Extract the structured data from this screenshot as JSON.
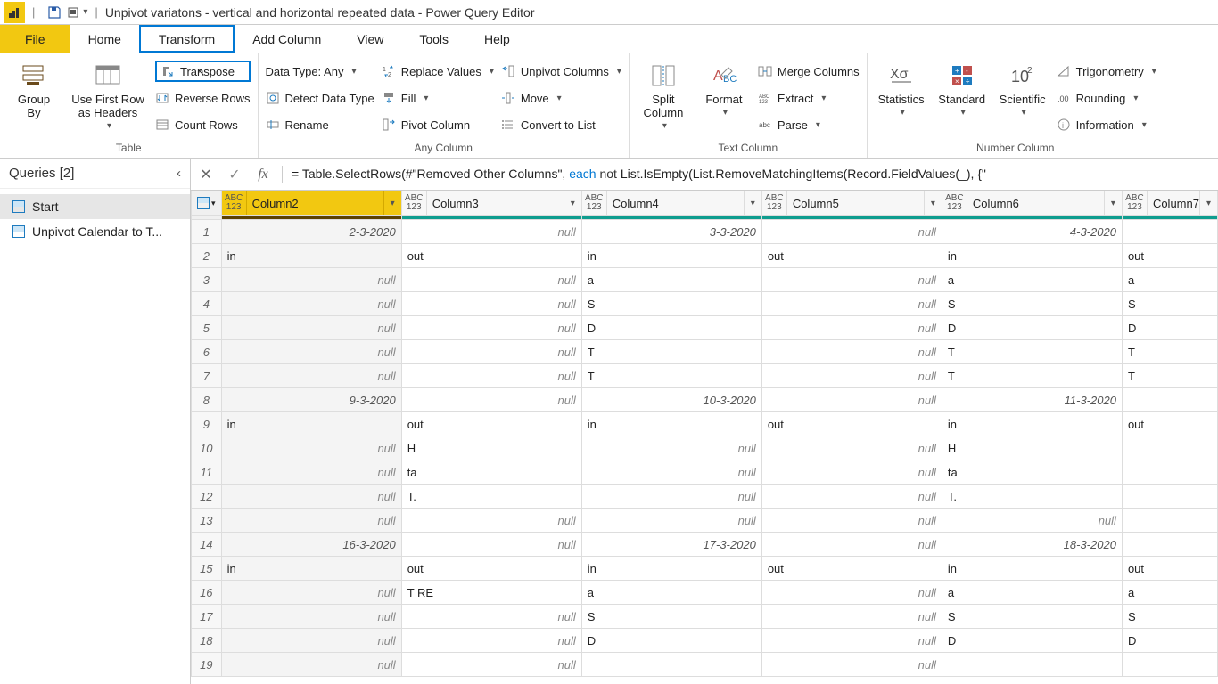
{
  "titlebar": {
    "title": "Unpivot variatons  - vertical and horizontal repeated data - Power Query Editor"
  },
  "menu": {
    "file": "File",
    "home": "Home",
    "transform": "Transform",
    "add_column": "Add Column",
    "view": "View",
    "tools": "Tools",
    "help": "Help"
  },
  "ribbon": {
    "table": {
      "label": "Table",
      "group_by": "Group\nBy",
      "use_first_row": "Use First Row\nas Headers",
      "transpose": "Transpose",
      "reverse_rows": "Reverse Rows",
      "count_rows": "Count Rows"
    },
    "any_column": {
      "label": "Any Column",
      "data_type": "Data Type: Any",
      "detect_data_type": "Detect Data Type",
      "rename": "Rename",
      "replace_values": "Replace Values",
      "fill": "Fill",
      "pivot": "Pivot Column",
      "unpivot": "Unpivot Columns",
      "move": "Move",
      "convert_to_list": "Convert to List"
    },
    "text_column": {
      "label": "Text Column",
      "split": "Split\nColumn",
      "format": "Format",
      "merge": "Merge Columns",
      "extract": "Extract",
      "parse": "Parse"
    },
    "number_column": {
      "label": "Number Column",
      "statistics": "Statistics",
      "standard": "Standard",
      "scientific": "Scientific",
      "trigonometry": "Trigonometry",
      "rounding": "Rounding",
      "information": "Information"
    }
  },
  "queries": {
    "header": "Queries [2]",
    "items": [
      "Start",
      "Unpivot Calendar to T..."
    ]
  },
  "formula": {
    "prefix": "= Table.SelectRows(#\"Removed Other Columns\", ",
    "each": "each",
    "not": " not ",
    "rest": "List.IsEmpty(List.RemoveMatchingItems(Record.FieldValues(_), {\""
  },
  "columns": [
    {
      "name": "Column2",
      "selected": true
    },
    {
      "name": "Column3",
      "selected": false
    },
    {
      "name": "Column4",
      "selected": false
    },
    {
      "name": "Column5",
      "selected": false
    },
    {
      "name": "Column6",
      "selected": false
    },
    {
      "name": "Column7",
      "selected": false
    }
  ],
  "type_icon_label": "ABC\n123",
  "rows": [
    {
      "n": 1,
      "c": [
        "2-3-2020",
        "null",
        "3-3-2020",
        "null",
        "4-3-2020",
        ""
      ],
      "align": [
        "r",
        "r",
        "r",
        "r",
        "r",
        "l"
      ]
    },
    {
      "n": 2,
      "c": [
        "in",
        "out",
        "in",
        "out",
        "in",
        "out"
      ],
      "align": [
        "l",
        "l",
        "l",
        "l",
        "l",
        "l"
      ]
    },
    {
      "n": 3,
      "c": [
        "null",
        "null",
        "a",
        "null",
        "a",
        "a"
      ],
      "align": [
        "r",
        "r",
        "l",
        "r",
        "l",
        "l"
      ]
    },
    {
      "n": 4,
      "c": [
        "null",
        "null",
        "S",
        "null",
        "S",
        "S"
      ],
      "align": [
        "r",
        "r",
        "l",
        "r",
        "l",
        "l"
      ]
    },
    {
      "n": 5,
      "c": [
        "null",
        "null",
        "D",
        "null",
        "D",
        "D"
      ],
      "align": [
        "r",
        "r",
        "l",
        "r",
        "l",
        "l"
      ]
    },
    {
      "n": 6,
      "c": [
        "null",
        "null",
        "T",
        "null",
        "T",
        "T"
      ],
      "align": [
        "r",
        "r",
        "l",
        "r",
        "l",
        "l"
      ]
    },
    {
      "n": 7,
      "c": [
        "null",
        "null",
        "T",
        "null",
        "T",
        "T"
      ],
      "align": [
        "r",
        "r",
        "l",
        "r",
        "l",
        "l"
      ]
    },
    {
      "n": 8,
      "c": [
        "9-3-2020",
        "null",
        "10-3-2020",
        "null",
        "11-3-2020",
        ""
      ],
      "align": [
        "r",
        "r",
        "r",
        "r",
        "r",
        "l"
      ]
    },
    {
      "n": 9,
      "c": [
        "in",
        "out",
        "in",
        "out",
        "in",
        "out"
      ],
      "align": [
        "l",
        "l",
        "l",
        "l",
        "l",
        "l"
      ]
    },
    {
      "n": 10,
      "c": [
        "null",
        "H",
        "null",
        "null",
        "H",
        ""
      ],
      "align": [
        "r",
        "l",
        "r",
        "r",
        "l",
        "l"
      ]
    },
    {
      "n": 11,
      "c": [
        "null",
        "ta",
        "null",
        "null",
        "ta",
        ""
      ],
      "align": [
        "r",
        "l",
        "r",
        "r",
        "l",
        "l"
      ]
    },
    {
      "n": 12,
      "c": [
        "null",
        "T.",
        "null",
        "null",
        "T.",
        ""
      ],
      "align": [
        "r",
        "l",
        "r",
        "r",
        "l",
        "l"
      ]
    },
    {
      "n": 13,
      "c": [
        "null",
        "null",
        "null",
        "null",
        "null",
        ""
      ],
      "align": [
        "r",
        "r",
        "r",
        "r",
        "r",
        "l"
      ]
    },
    {
      "n": 14,
      "c": [
        "16-3-2020",
        "null",
        "17-3-2020",
        "null",
        "18-3-2020",
        ""
      ],
      "align": [
        "r",
        "r",
        "r",
        "r",
        "r",
        "l"
      ]
    },
    {
      "n": 15,
      "c": [
        "in",
        "out",
        "in",
        "out",
        "in",
        "out"
      ],
      "align": [
        "l",
        "l",
        "l",
        "l",
        "l",
        "l"
      ]
    },
    {
      "n": 16,
      "c": [
        "null",
        "T RE",
        "a",
        "null",
        "a",
        "a"
      ],
      "align": [
        "r",
        "l",
        "l",
        "r",
        "l",
        "l"
      ]
    },
    {
      "n": 17,
      "c": [
        "null",
        "null",
        "S",
        "null",
        "S",
        "S"
      ],
      "align": [
        "r",
        "r",
        "l",
        "r",
        "l",
        "l"
      ]
    },
    {
      "n": 18,
      "c": [
        "null",
        "null",
        "D",
        "null",
        "D",
        "D"
      ],
      "align": [
        "r",
        "r",
        "l",
        "r",
        "l",
        "l"
      ]
    },
    {
      "n": 19,
      "c": [
        "null",
        "null",
        "",
        "null",
        "",
        ""
      ],
      "align": [
        "r",
        "r",
        "l",
        "r",
        "l",
        "l"
      ]
    }
  ]
}
